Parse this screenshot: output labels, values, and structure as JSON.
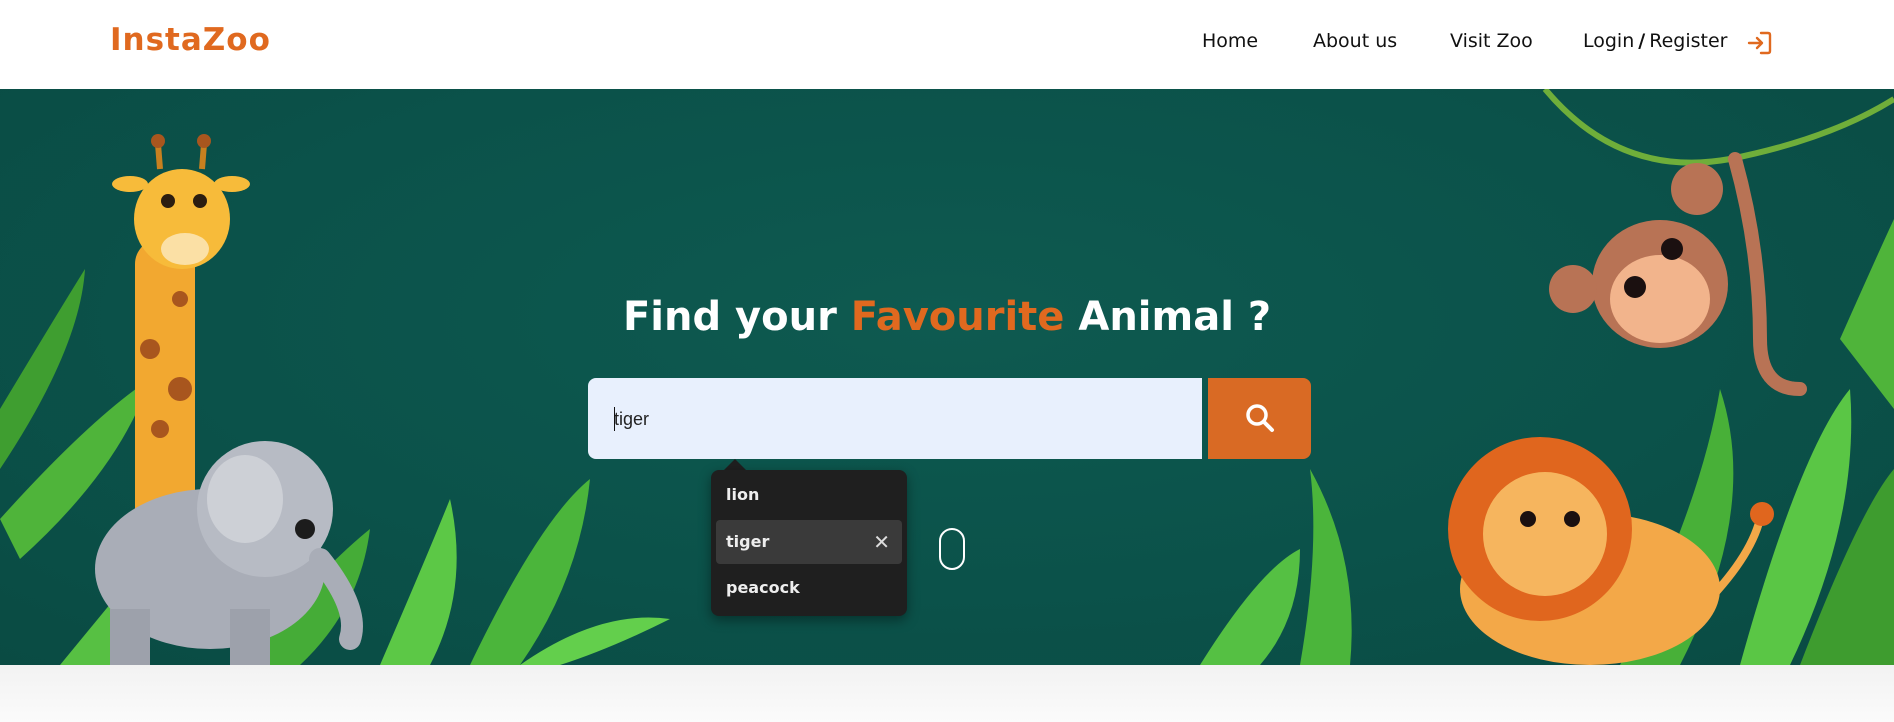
{
  "header": {
    "logo": "InstaZoo",
    "nav": {
      "home": "Home",
      "about": "About us",
      "visit": "Visit Zoo",
      "login": "Login",
      "separator": "/",
      "register": "Register"
    },
    "login_icon": "sign-in-icon"
  },
  "hero": {
    "title_part1": "Find your",
    "title_accent": "Favourite",
    "title_part2": "Animal ?",
    "search": {
      "value": "tiger",
      "button_icon": "search-icon"
    },
    "suggestions": [
      {
        "label": "lion"
      },
      {
        "label": "tiger"
      },
      {
        "label": "peacock"
      }
    ],
    "suggestion_remove_icon": "close-icon"
  },
  "colors": {
    "brand": "#e0691f",
    "hero_bg": "#0c554c",
    "header_bg": "#ffffff",
    "search_bg": "#e8f0fd",
    "button_bg": "#d96a24"
  }
}
